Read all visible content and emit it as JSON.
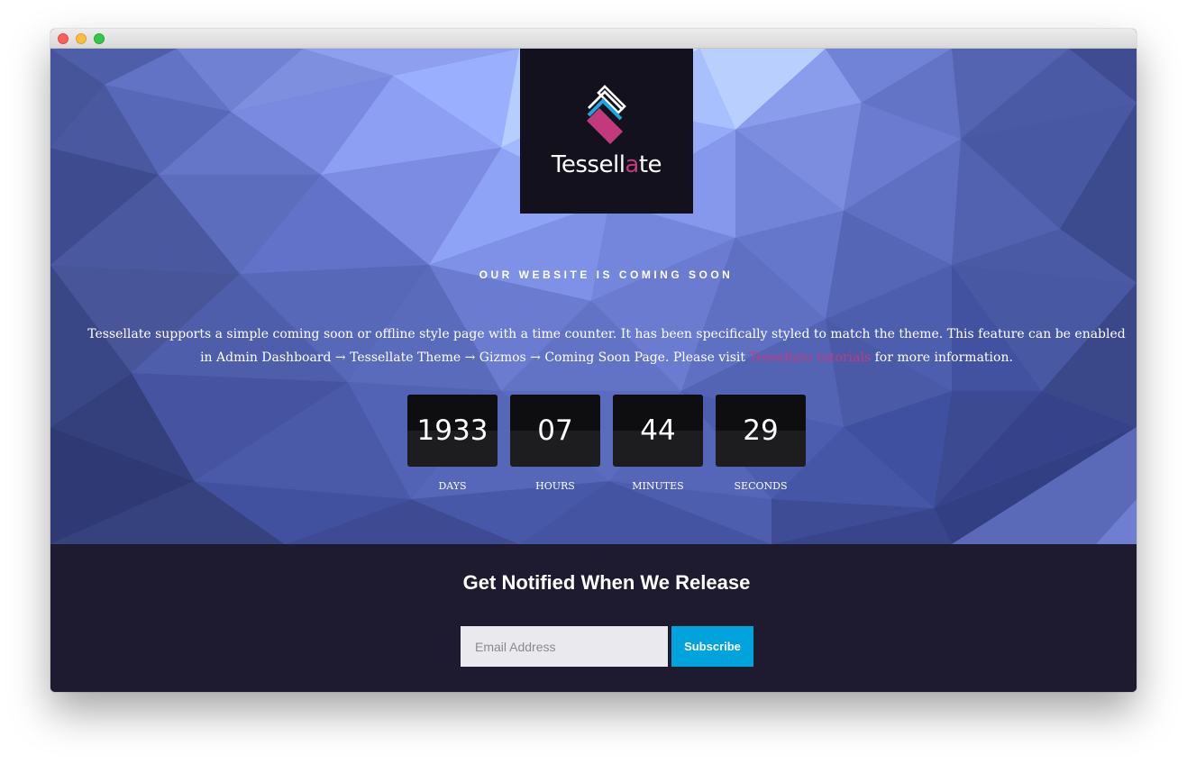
{
  "window": {
    "controls": [
      "close",
      "minimize",
      "zoom"
    ]
  },
  "logo": {
    "text_before": "Tessell",
    "text_accent": "a",
    "text_after": "te",
    "accent_color": "#c33a7c",
    "mark_colors": [
      "#ffffff",
      "#1aa7e0",
      "#c33a7c"
    ]
  },
  "hero": {
    "heading": "OUR WEBSITE IS COMING SOON",
    "description_before": "Tessellate supports a simple coming soon or offline style page with a time counter. It has been specifically styled to match the theme. This feature can be enabled in Admin Dashboard → Tessellate Theme → Gizmos → Coming Soon Page. Please visit ",
    "description_link": "Tessellate tutorials",
    "description_after": " for more information."
  },
  "countdown": [
    {
      "value": "1933",
      "label": "DAYS"
    },
    {
      "value": "07",
      "label": "HOURS"
    },
    {
      "value": "44",
      "label": "MINUTES"
    },
    {
      "value": "29",
      "label": "SECONDS"
    }
  ],
  "notify": {
    "title": "Get Notified When We Release",
    "email_placeholder": "Email Address",
    "email_value": "",
    "subscribe_label": "Subscribe",
    "subscribe_color": "#00a3dc"
  },
  "colors": {
    "footer_bg": "#1e1a2f",
    "logo_bg": "#14111f",
    "hero_base": "#5a68b8"
  }
}
